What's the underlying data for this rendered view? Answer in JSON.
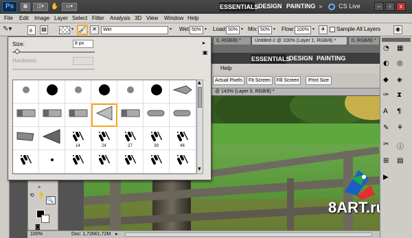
{
  "app": {
    "logo": "Ps",
    "workspaces": [
      "ESSENTIALS",
      "DESIGN",
      "PAINTING"
    ],
    "more": "»",
    "cs_live": "CS Live",
    "win_minimize": "–",
    "win_restore": "▫",
    "win_close": "x"
  },
  "menu": [
    "File",
    "Edit",
    "Image",
    "Layer",
    "Select",
    "Filter",
    "Analysis",
    "3D",
    "View",
    "Window",
    "Help"
  ],
  "options": {
    "brush_size": "8",
    "preset": "Wet",
    "wet_label": "Wet:",
    "wet_value": "50%",
    "load_label": "Load:",
    "load_value": "50%",
    "mix_label": "Mix:",
    "mix_value": "50%",
    "flow_label": "Flow:",
    "flow_value": "100%",
    "sample_label": "Sample All Layers"
  },
  "doc_tabs": [
    "0, RGB/8) *",
    "Untitled-2 @ 100% (Layer 1, RGB/8) *",
    "0, RGB/8) *"
  ],
  "doc2": {
    "workspaces": [
      "ESSENTIALS",
      "DESIGN",
      "PAINTING"
    ],
    "help": "Help",
    "buttons": [
      "Actual Pixels",
      "Fit Screen",
      "Fill Screen",
      "Print Size"
    ],
    "tab": "@ 143% (Layer 0, RGB/8) *"
  },
  "brush_panel": {
    "size_label": "Size:",
    "size_value": "8 px",
    "hardness_label": "Hardness:",
    "cells": [
      {
        "name": ""
      },
      {
        "name": ""
      },
      {
        "name": ""
      },
      {
        "name": ""
      },
      {
        "name": ""
      },
      {
        "name": ""
      },
      {
        "name": ""
      },
      {
        "name": ""
      },
      {
        "name": ""
      },
      {
        "name": ""
      },
      {
        "name": ""
      },
      {
        "name": ""
      },
      {
        "name": ""
      },
      {
        "name": ""
      },
      {
        "name": ""
      },
      {
        "name": ""
      },
      {
        "name": "14"
      },
      {
        "name": "24"
      },
      {
        "name": "27"
      },
      {
        "name": "39"
      },
      {
        "name": "46"
      },
      {
        "name": ""
      },
      {
        "name": ""
      },
      {
        "name": ""
      },
      {
        "name": ""
      },
      {
        "name": ""
      },
      {
        "name": ""
      },
      {
        "name": ""
      }
    ]
  },
  "status": {
    "zoom": "100%",
    "doc": "Doc: 1,72M/1,72M"
  },
  "watermark": "8ART.ru",
  "colors": {
    "accent": "#f5a623",
    "appbar": "#3a3a3a",
    "panel": "#e4e1dd"
  }
}
